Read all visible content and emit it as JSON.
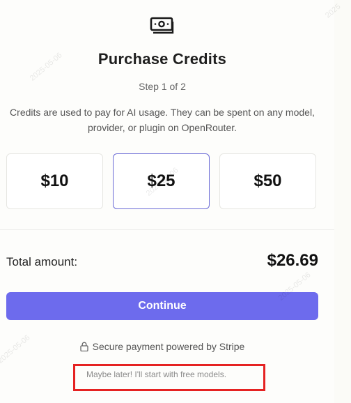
{
  "header": {
    "icon": "money-icon",
    "title": "Purchase Credits",
    "step": "Step 1 of 2",
    "description": "Credits are used to pay for AI usage. They can be spent on any model, provider, or plugin on OpenRouter."
  },
  "amounts": [
    {
      "label": "$10",
      "selected": false
    },
    {
      "label": "$25",
      "selected": true
    },
    {
      "label": "$50",
      "selected": false
    }
  ],
  "total": {
    "label": "Total amount:",
    "value": "$26.69"
  },
  "continue_label": "Continue",
  "secure_text": "Secure payment powered by Stripe",
  "later_link": "Maybe later! I'll start with free models.",
  "colors": {
    "accent": "#6d6bed",
    "selected_border": "#6b6bd6",
    "highlight": "#e52222"
  },
  "watermarks": [
    "2025-05-06",
    "2025-05-06",
    "2025-05-06",
    "2025-05-06",
    "2025"
  ]
}
